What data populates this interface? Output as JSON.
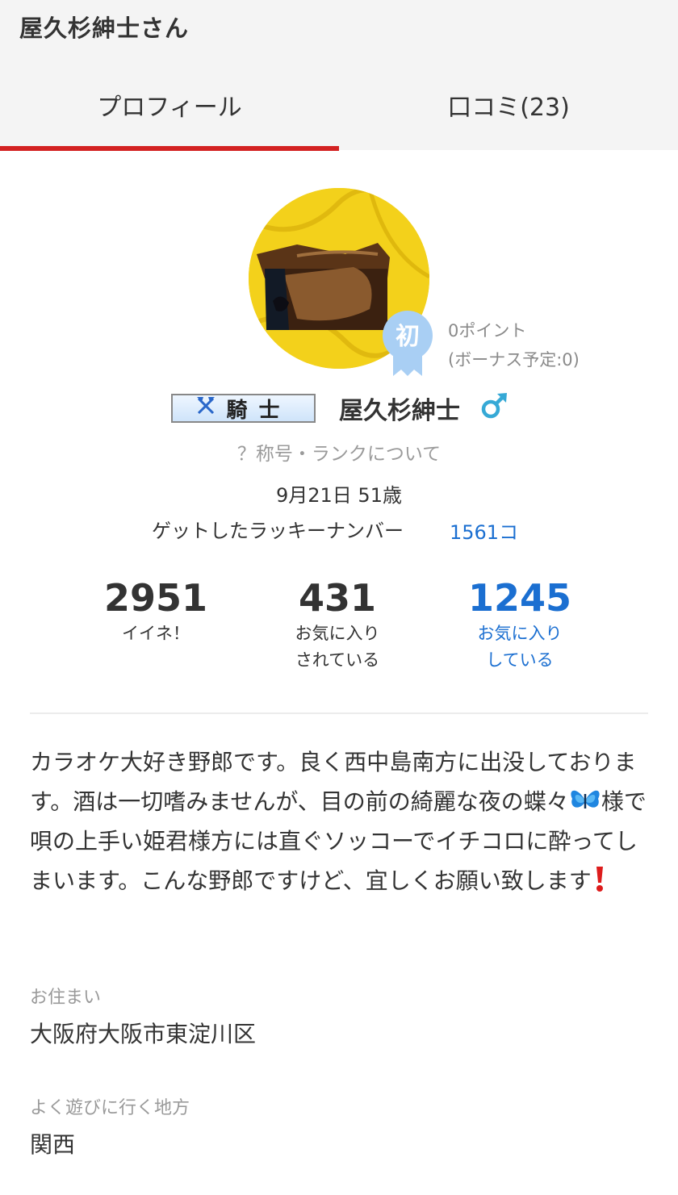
{
  "header": {
    "title": "屋久杉紳士さん",
    "tabs": [
      {
        "label": "プロフィール",
        "active": true
      },
      {
        "label": "口コミ(23)",
        "active": false
      }
    ],
    "active_color": "#d32222"
  },
  "profile": {
    "avatar_icon": "avatar-photo",
    "badge_text": "初",
    "points": "0ポイント",
    "bonus": "(ボーナス予定:0)",
    "rank_icon": "crossed-axes-icon",
    "rank_label": "騎士",
    "name": "屋久杉紳士",
    "gender_icon": "male-icon",
    "title_link": "？称号・ランクについて",
    "birthday": "9月21日 51歳",
    "lucky_label": "ゲットしたラッキーナンバー",
    "lucky_value": "1561コ"
  },
  "stats": [
    {
      "value": "2951",
      "label_line1": "イイネ！",
      "label_line2": ""
    },
    {
      "value": "431",
      "label_line1": "お気に入り",
      "label_line2": "されている"
    },
    {
      "value": "1245",
      "label_line1": "お気に入り",
      "label_line2": "している",
      "color": "#1b6fd1"
    }
  ],
  "bio": {
    "part1": "カラオケ大好き野郎です。良く西中島南方に出没しております。酒は一切嗜みませんが、目の前の綺麗な夜の蝶々",
    "part2": "様で唄の上手い姫君様方には直ぐソッコーでイチコロに酔ってしまいます。こんな野郎ですけど、宜しくお願い致します",
    "emoji_1": "butterfly-emoji",
    "emoji_2": "exclamation-emoji"
  },
  "details": {
    "residence_label": "お住まい",
    "residence_value": "大阪府大阪市東淀川区",
    "region_label": "よく遊びに行く地方",
    "region_value": "関西"
  }
}
